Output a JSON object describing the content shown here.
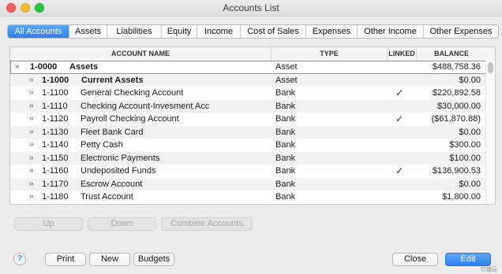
{
  "window": {
    "title": "Accounts List"
  },
  "tabs": [
    {
      "label": "All Accounts",
      "active": true
    },
    {
      "label": "Assets"
    },
    {
      "label": "Liabilities"
    },
    {
      "label": "Equity"
    },
    {
      "label": "Income"
    },
    {
      "label": "Cost of Sales"
    },
    {
      "label": "Expenses"
    },
    {
      "label": "Other Income"
    },
    {
      "label": "Other Expenses"
    }
  ],
  "table": {
    "headers": {
      "name": "ACCOUNT NAME",
      "type": "TYPE",
      "linked": "LINKED",
      "balance": "BALANCE"
    },
    "rows": [
      {
        "number": "1-0000",
        "name": "Assets",
        "type": "Asset",
        "linked": "",
        "balance": "$488,758.36",
        "level": 0
      },
      {
        "number": "1-1000",
        "name": "Current Assets",
        "type": "Asset",
        "linked": "",
        "balance": "$0.00",
        "level": 1
      },
      {
        "number": "1-1100",
        "name": "General Checking Account",
        "type": "Bank",
        "linked": "✓",
        "balance": "$220,892.58",
        "level": 2
      },
      {
        "number": "1-1110",
        "name": "Checking Account-Invesment Acc",
        "type": "Bank",
        "linked": "",
        "balance": "$30,000.00",
        "level": 2
      },
      {
        "number": "1-1120",
        "name": "Payroll Checking Account",
        "type": "Bank",
        "linked": "✓",
        "balance": "($61,870.88)",
        "level": 2
      },
      {
        "number": "1-1130",
        "name": "Fleet Bank Card",
        "type": "Bank",
        "linked": "",
        "balance": "$0.00",
        "level": 2
      },
      {
        "number": "1-1140",
        "name": "Petty Cash",
        "type": "Bank",
        "linked": "",
        "balance": "$300.00",
        "level": 2
      },
      {
        "number": "1-1150",
        "name": "Electronic Payments",
        "type": "Bank",
        "linked": "",
        "balance": "$100.00",
        "level": 2
      },
      {
        "number": "1-1160",
        "name": "Undeposited Funds",
        "type": "Bank",
        "linked": "✓",
        "balance": "$136,900.53",
        "level": 2
      },
      {
        "number": "1-1170",
        "name": "Escrow Account",
        "type": "Bank",
        "linked": "",
        "balance": "$0.00",
        "level": 2
      },
      {
        "number": "1-1180",
        "name": "Trust Account",
        "type": "Bank",
        "linked": "",
        "balance": "$1,800.00",
        "level": 2
      }
    ]
  },
  "row_actions": {
    "up": "Up",
    "down": "Down",
    "combine": "Combine Accounts"
  },
  "footer": {
    "help": "?",
    "print": "Print",
    "new": "New",
    "budgets": "Budgets",
    "close": "Close",
    "edit": "Edit"
  },
  "watermark": "亿速云"
}
